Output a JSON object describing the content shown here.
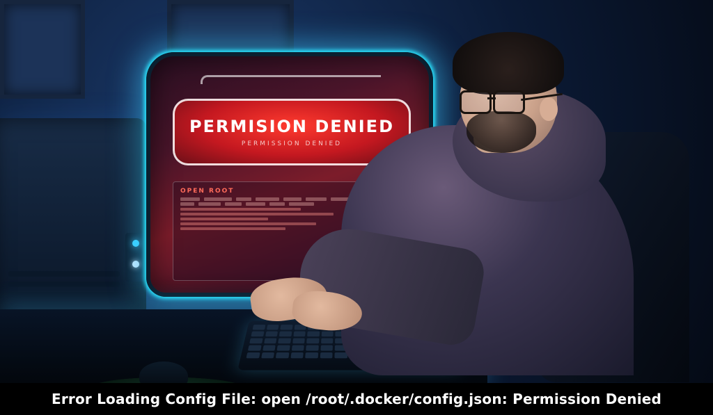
{
  "screen": {
    "error_title": "PERMISION DENIED",
    "error_subtext": "PERMISSION DENIED"
  },
  "caption": {
    "text": "Error Loading Config File: open /root/.docker/config.json: Permission Denied"
  }
}
